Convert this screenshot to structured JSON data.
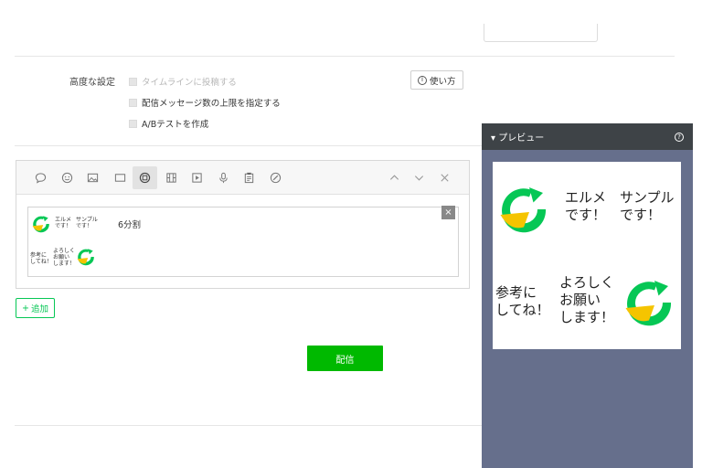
{
  "advanced": {
    "label": "高度な設定",
    "options": [
      {
        "label": "タイムラインに投稿する",
        "disabled": true
      },
      {
        "label": "配信メッセージ数の上限を指定する",
        "disabled": false
      },
      {
        "label": "A/Bテストを作成",
        "disabled": false
      }
    ],
    "howto_label": "使い方",
    "howto_icon": "info-icon"
  },
  "editor": {
    "toolbar_icons": [
      "speech-bubble-icon",
      "smiley-icon",
      "image-icon",
      "card-icon",
      "imagemap-icon",
      "video-rich-icon",
      "video-icon",
      "microphone-icon",
      "clipboard-icon",
      "coupon-icon",
      "chevron-up-icon",
      "chevron-down-icon",
      "close-icon"
    ],
    "split_label": "6分割",
    "close_label": "×",
    "tiles": {
      "t2_l1": "エルメ",
      "t2_l2": "です！",
      "t3_l1": "サンプル",
      "t3_l2": "です！",
      "t4_l1": "参考に",
      "t4_l2": "してね！",
      "t5_l1": "よろしく",
      "t5_l2": "お願い",
      "t5_l3": "します！"
    }
  },
  "add_button": {
    "plus": "+",
    "label": "追加"
  },
  "send_button": {
    "label": "配信"
  },
  "preview": {
    "title": "プレビュー",
    "caret": "▾",
    "help": "?",
    "texts": {
      "a1": "エルメ",
      "a2": "です！",
      "b1": "サンプル",
      "b2": "です！",
      "c1": "参考に",
      "c2": "してね！",
      "d1": "よろしく",
      "d2": "お願い",
      "d3": "します！"
    }
  },
  "colors": {
    "green": "#06c755",
    "send": "#00b900",
    "preview_bg": "#666f8c",
    "logo_yellow": "#f5c400"
  }
}
